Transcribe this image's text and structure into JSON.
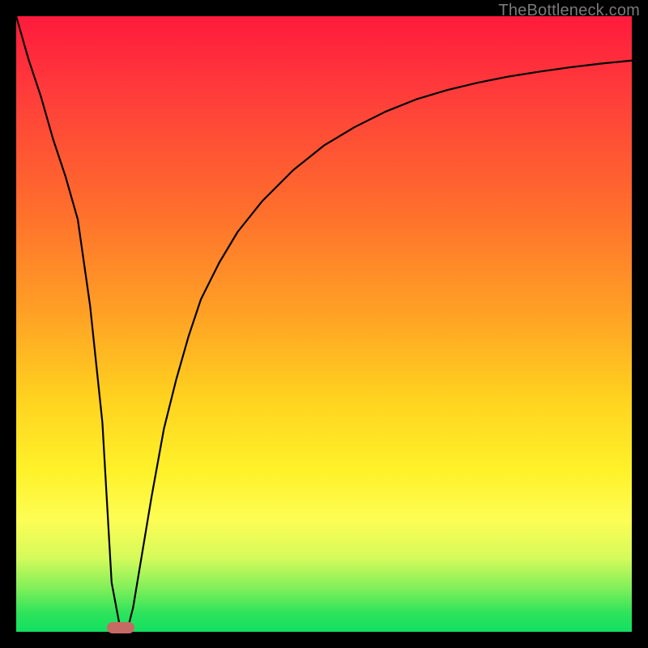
{
  "watermark": "TheBottleneck.com",
  "colors": {
    "frame": "#000000",
    "gradient_top": "#ff1a3c",
    "gradient_mid1": "#ffa025",
    "gradient_mid2": "#fff22a",
    "gradient_bottom": "#12e062",
    "curve": "#000000",
    "marker": "#c76a64"
  },
  "chart_data": {
    "type": "line",
    "title": "",
    "xlabel": "",
    "ylabel": "",
    "xlim": [
      0,
      100
    ],
    "ylim": [
      0,
      100
    ],
    "series": [
      {
        "name": "curve",
        "x": [
          0,
          2,
          4,
          6,
          8,
          10,
          12,
          14,
          15.5,
          17,
          18,
          19,
          20,
          22,
          24,
          26,
          28,
          30,
          33,
          36,
          40,
          45,
          50,
          55,
          60,
          65,
          70,
          75,
          80,
          85,
          90,
          95,
          100
        ],
        "y": [
          100,
          93,
          87,
          80,
          74,
          67,
          53,
          34,
          8,
          0,
          0,
          4,
          10,
          22,
          33,
          41,
          48,
          54,
          60,
          65,
          70,
          75,
          79,
          82,
          84.5,
          86.5,
          88,
          89.2,
          90.2,
          91,
          91.7,
          92.3,
          92.8
        ]
      }
    ],
    "marker": {
      "x_center": 17.0,
      "y": 0,
      "width_pct": 4.5
    },
    "grid": false,
    "legend": false
  }
}
